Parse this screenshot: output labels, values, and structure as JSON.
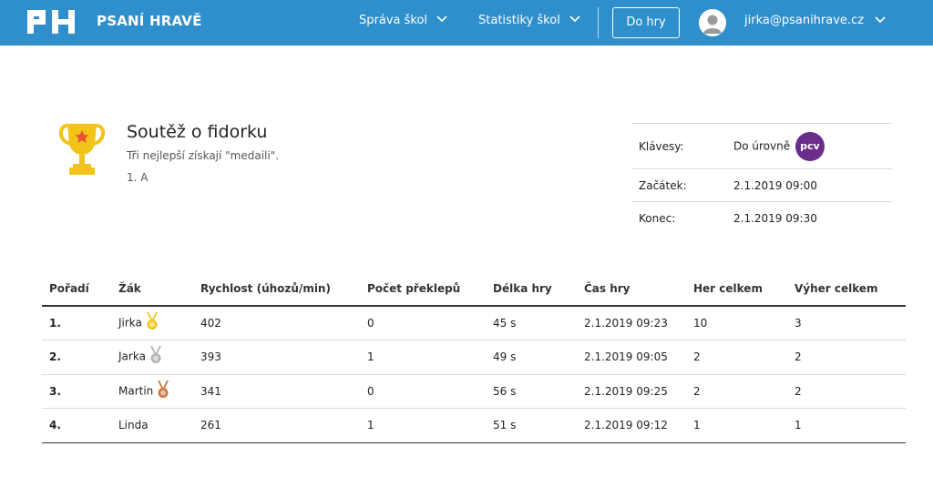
{
  "header": {
    "brand": "PSANÍ HRAVĚ",
    "logo_text": "PH",
    "nav": [
      {
        "label": "Správa škol"
      },
      {
        "label": "Statistiky škol"
      }
    ],
    "play_button": "Do hry",
    "user_email": "jirka@psanihrave.cz",
    "icons": [
      "chevron-down-icon",
      "user-avatar-icon"
    ],
    "colors": {
      "bar": "#2f8fcd"
    }
  },
  "competition": {
    "title": "Soutěž o fidorku",
    "description": "Tři nejlepší získají \"medaili\".",
    "class": "1. A",
    "icon": "trophy-icon",
    "info": {
      "keys_label": "Klávesy:",
      "keys_value": "Do úrovně",
      "keys_badge": "pcv",
      "start_label": "Začátek:",
      "start_value": "2.1.2019 09:00",
      "end_label": "Konec:",
      "end_value": "2.1.2019 09:30"
    }
  },
  "results": {
    "columns": [
      "Pořadí",
      "Žák",
      "Rychlost (úhozů/min)",
      "Počet překlepů",
      "Délka hry",
      "Čas hry",
      "Her celkem",
      "Výher celkem"
    ],
    "rows": [
      {
        "rank": "1.",
        "name": "Jirka",
        "medal": "gold",
        "speed": "402",
        "errors": "0",
        "length": "45 s",
        "time": "2.1.2019 09:23",
        "games": "10",
        "wins": "3"
      },
      {
        "rank": "2.",
        "name": "Jarka",
        "medal": "silver",
        "speed": "393",
        "errors": "1",
        "length": "49 s",
        "time": "2.1.2019 09:05",
        "games": "2",
        "wins": "2"
      },
      {
        "rank": "3.",
        "name": "Martin",
        "medal": "bronze",
        "speed": "341",
        "errors": "0",
        "length": "56 s",
        "time": "2.1.2019 09:25",
        "games": "2",
        "wins": "2"
      },
      {
        "rank": "4.",
        "name": "Linda",
        "medal": "",
        "speed": "261",
        "errors": "1",
        "length": "51 s",
        "time": "2.1.2019 09:12",
        "games": "1",
        "wins": "1"
      }
    ],
    "medal_colors": {
      "gold": "#f2c318",
      "silver": "#b5b5b5",
      "bronze": "#c9773a"
    }
  }
}
